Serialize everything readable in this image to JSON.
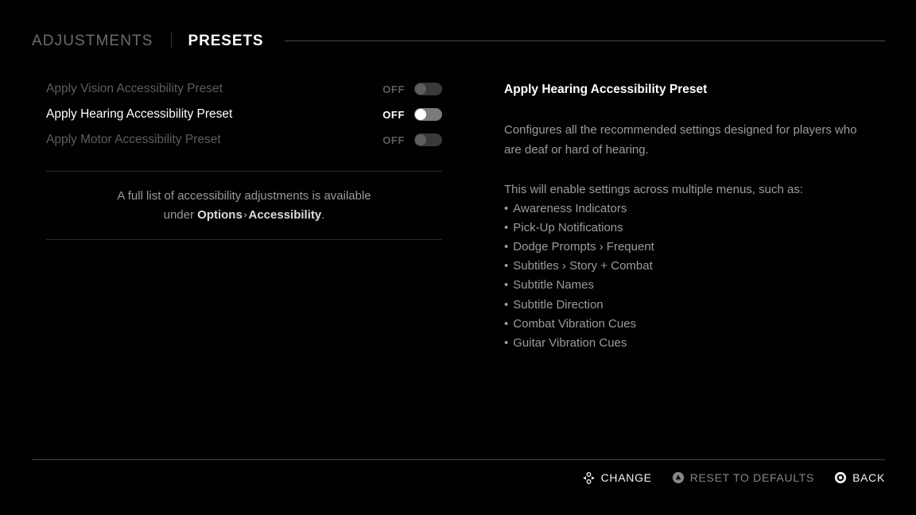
{
  "header": {
    "tabs": [
      {
        "label": "ADJUSTMENTS",
        "active": false
      },
      {
        "label": "PRESETS",
        "active": true
      }
    ]
  },
  "settings": {
    "rows": [
      {
        "label": "Apply Vision Accessibility Preset",
        "value": "OFF",
        "selected": false,
        "toggle_state": "off"
      },
      {
        "label": "Apply Hearing Accessibility Preset",
        "value": "OFF",
        "selected": true,
        "toggle_state": "off"
      },
      {
        "label": "Apply Motor Accessibility Preset",
        "value": "OFF",
        "selected": false,
        "toggle_state": "off"
      }
    ],
    "note": {
      "line1": "A full list of accessibility adjustments is available",
      "line2_prefix": "under ",
      "line2_bold1": "Options",
      "line2_chevron": "›",
      "line2_bold2": "Accessibility",
      "line2_suffix": "."
    }
  },
  "detail": {
    "title": "Apply Hearing Accessibility Preset",
    "description": "Configures all the recommended settings designed for players who are deaf or hard of hearing.",
    "list_intro": "This will enable settings across multiple menus, such as:",
    "bullet_char": "•",
    "items": [
      "Awareness Indicators",
      "Pick-Up Notifications",
      "Dodge Prompts › Frequent",
      "Subtitles › Story + Combat",
      "Subtitle Names",
      "Subtitle Direction",
      "Combat Vibration Cues",
      "Guitar Vibration Cues"
    ]
  },
  "footer": {
    "prompts": [
      {
        "label": "CHANGE",
        "icon": "dpad-icon",
        "enabled": true
      },
      {
        "label": "RESET TO DEFAULTS",
        "icon": "triangle-button-icon",
        "enabled": false
      },
      {
        "label": "BACK",
        "icon": "circle-button-icon",
        "enabled": true
      }
    ]
  },
  "colors": {
    "background": "#010101",
    "text_primary": "#ffffff",
    "text_secondary": "#9b9b9b",
    "text_dim": "#5d5d5d",
    "rule": "#4a4a4a",
    "toggle_on_track": "#7b7b7b",
    "toggle_off_track": "#393939"
  }
}
